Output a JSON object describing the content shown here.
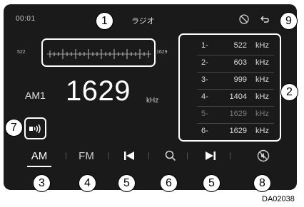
{
  "status_bar": {
    "clock": "00:01",
    "title": "ラジオ",
    "icons": [
      "no-cellular-icon",
      "back-icon"
    ]
  },
  "tuner": {
    "scale_min": "522",
    "scale_max": "1629"
  },
  "station": {
    "band_label": "AM1",
    "frequency": "1629",
    "unit": "kHz"
  },
  "presets": [
    {
      "number": "1-",
      "frequency": "522",
      "unit": "kHz"
    },
    {
      "number": "2-",
      "frequency": "603",
      "unit": "kHz"
    },
    {
      "number": "3-",
      "frequency": "999",
      "unit": "kHz"
    },
    {
      "number": "4-",
      "frequency": "1404",
      "unit": "kHz"
    },
    {
      "number": "5-",
      "frequency": "1629",
      "unit": "kHz"
    },
    {
      "number": "6-",
      "frequency": "1629",
      "unit": "kHz"
    }
  ],
  "bottom_bar": {
    "am_label": "AM",
    "fm_label": "FM",
    "icons": [
      "seek-back-icon",
      "search-icon",
      "seek-forward-icon",
      "no-sound-icon"
    ]
  },
  "callouts": [
    "1",
    "2",
    "3",
    "4",
    "5",
    "6",
    "5",
    "8",
    "7",
    "9"
  ],
  "figure_code": "DA02038"
}
